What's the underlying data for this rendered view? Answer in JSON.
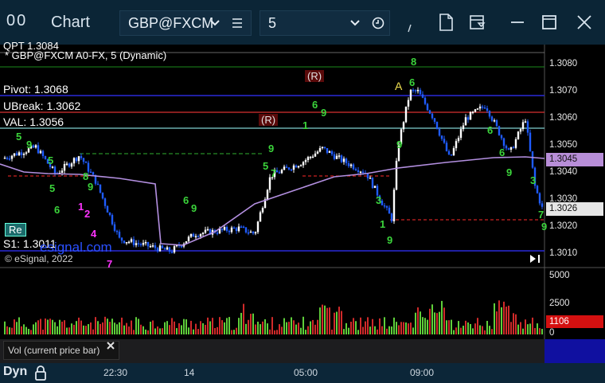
{
  "titlebar": {
    "app_title": "Chart",
    "symbol": "GBP@FXCM",
    "interval": "5"
  },
  "chart": {
    "study_line_top": "QPT 1.3084",
    "symbol_line": "* GBP@FXCM A0-FX, 5 (Dynamic)",
    "pivot": "Pivot: 1.3068",
    "ubreak": "UBreak: 1.3062",
    "val": "VAL: 1.3056",
    "s1": "S1: 1.3011",
    "copyright": "© eSignal, 2022",
    "watermark": "esignal.com",
    "badge_r1": "R",
    "badge_r2": "R",
    "marker_a": "A",
    "corner_button": "Re",
    "price_ticks": [
      "1.3080",
      "1.3070",
      "1.3060",
      "1.3050",
      "1.3040",
      "1.3030",
      "1.3020",
      "1.3010"
    ],
    "price_marker_vwap": "1.3045",
    "price_marker_last": "1.3026",
    "volume_ticks": [
      "5000",
      "2500",
      "0"
    ],
    "volume_marker": "1106",
    "volume_label": "Vol (current price bar)"
  },
  "time_axis": {
    "ticks": [
      "22:30",
      "14",
      "05:00",
      "09:00"
    ],
    "mode": "Dyn"
  },
  "colors": {
    "up": "#ffffff",
    "down": "#1f5cff",
    "vwap": "#b38fe0",
    "pivot_line": "#2a2ad8",
    "ubreak_line": "#d83030",
    "val_line": "#7fd0d0",
    "vol_up": "#5fcf3a",
    "vol_down": "#d02a2a",
    "counter_green": "#3bd43b",
    "counter_magenta": "#ff33ff"
  }
}
